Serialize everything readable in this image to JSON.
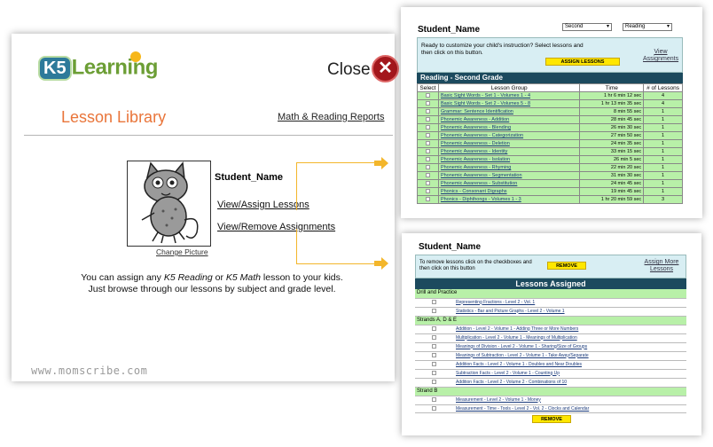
{
  "main": {
    "logo_k5": "K5",
    "logo_text": "Learning",
    "close_label": "Close",
    "close_icon": "✕",
    "title": "Lesson Library",
    "reports_link": "Math & Reading Reports",
    "change_picture": "Change Picture",
    "student_name": "Student_Name",
    "assign_link": "View/Assign Lessons",
    "remove_link": "View/Remove Assignments",
    "info_line1_a": "You can assign any ",
    "info_line1_reading": "K5 Reading",
    "info_line1_or": " or ",
    "info_line1_math": "K5 Math",
    "info_line1_b": " lesson to your kids.",
    "info_line2": "Just browse through our lessons by subject and grade level.",
    "watermark": "www.momscribe.com"
  },
  "assign_panel": {
    "student_name": "Student_Name",
    "grade_select": "Second",
    "subject_select": "Reading",
    "ready_text": "Ready to customize your child's instruction? Select lessons and then click on this button.",
    "assign_button": "ASSIGN LESSONS",
    "view_assignments": "View Assignments",
    "grade_bar": "Reading - Second Grade",
    "headers": [
      "Select",
      "Lesson Group",
      "Time",
      "# of Lessons"
    ],
    "rows": [
      {
        "group": "Basic Sight Words - Set 1 - Volumes 1 - 4",
        "time": "1 hr 6 min 12 sec",
        "count": "4"
      },
      {
        "group": "Basic Sight Words - Set 2 - Volumes 5 - 8",
        "time": "1 hr 13 min 35 sec",
        "count": "4"
      },
      {
        "group": "Grammar: Sentence Identification",
        "time": "8 min 55 sec",
        "count": "1"
      },
      {
        "group": "Phonemic Awareness - Addition",
        "time": "28 min 45 sec",
        "count": "1"
      },
      {
        "group": "Phonemic Awareness - Blending",
        "time": "26 min 30 sec",
        "count": "1"
      },
      {
        "group": "Phonemic Awareness - Categorization",
        "time": "27 min 50 sec",
        "count": "1"
      },
      {
        "group": "Phonemic Awareness - Deletion",
        "time": "24 min 35 sec",
        "count": "1"
      },
      {
        "group": "Phonemic Awareness - Identity",
        "time": "33 min 15 sec",
        "count": "1"
      },
      {
        "group": "Phonemic Awareness - Isolation",
        "time": "26 min 5 sec",
        "count": "1"
      },
      {
        "group": "Phonemic Awareness - Rhyming",
        "time": "22 min 20 sec",
        "count": "1"
      },
      {
        "group": "Phonemic Awareness - Segmentation",
        "time": "31 min 30 sec",
        "count": "1"
      },
      {
        "group": "Phonemic Awareness - Substitution",
        "time": "24 min 45 sec",
        "count": "1"
      },
      {
        "group": "Phonics - Consonant Digraphs",
        "time": "19 min 45 sec",
        "count": "1"
      },
      {
        "group": "Phonics - Diphthongs - Volumes 1 - 3",
        "time": "1 hr 20 min 59 sec",
        "count": "3"
      }
    ]
  },
  "remove_panel": {
    "student_name": "Student_Name",
    "remove_text": "To remove lessons click on the checkboxes and then click on this button",
    "remove_button": "REMOVE",
    "assign_more": "Assign More Lessons",
    "assigned_bar": "Lessons Assigned",
    "sections": [
      {
        "title": "Drill and Practice",
        "items": [
          "Representing Fractions - Level 2 - Vol. 1",
          "Statistics - Bar and Picture Graphs - Level 2 - Volume 1"
        ]
      },
      {
        "title": "Strands A, D & E",
        "items": [
          "Addition - Level 2 - Volume 1 - Adding Three or More Numbers",
          "Multiplication - Level 2 - Volume 1 - Meanings of Multiplication",
          "Meanings of Division - Level 2 - Volume 1 - Sharing/Size of Groups",
          "Meanings of Subtraction - Level 2 - Volume 1 - Take Away/Separate",
          "Addition Facts - Level 2 - Volume 1 - Doubles and Near Doubles",
          "Subtraction Facts - Level 2 - Volume 1 - Counting Up",
          "Addition Facts - Level 2 - Volume 2 - Combinations of 10"
        ]
      },
      {
        "title": "Strand B",
        "items": [
          "Measurement - Level 2 - Volume 1 - Money",
          "Measurement - Time - Tools - Level 2 - Vol. 2 - Clocks and Calendar"
        ]
      }
    ],
    "footer_remove_button": "REMOVE"
  },
  "colors": {
    "accent_orange": "#e9753a",
    "header_blue": "#1c4a5e",
    "row_green": "#b8f0a8",
    "info_blue": "#d8eef3",
    "button_yellow": "#ffe700",
    "arrow_yellow": "#f3b62b",
    "close_red": "#a3171c"
  }
}
